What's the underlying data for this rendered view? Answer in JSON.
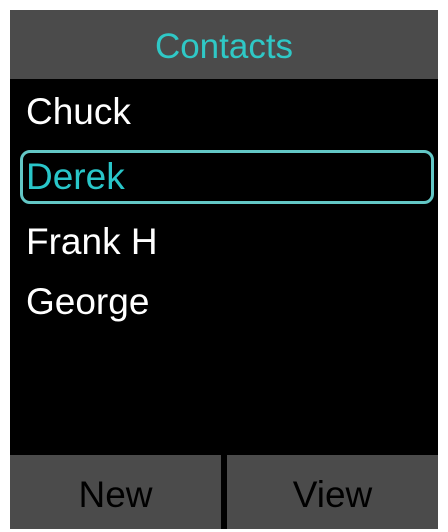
{
  "header": {
    "title": "Contacts"
  },
  "contacts": [
    {
      "name": "Chuck",
      "selected": false
    },
    {
      "name": "Derek",
      "selected": true
    },
    {
      "name": "Frank H",
      "selected": false
    },
    {
      "name": "George",
      "selected": false
    }
  ],
  "softkeys": {
    "left_label": "New",
    "right_label": "View"
  },
  "colors": {
    "accent": "#2fc8c6",
    "bar_background": "#4b4b4b",
    "screen_background": "#000000",
    "text": "#ffffff"
  }
}
